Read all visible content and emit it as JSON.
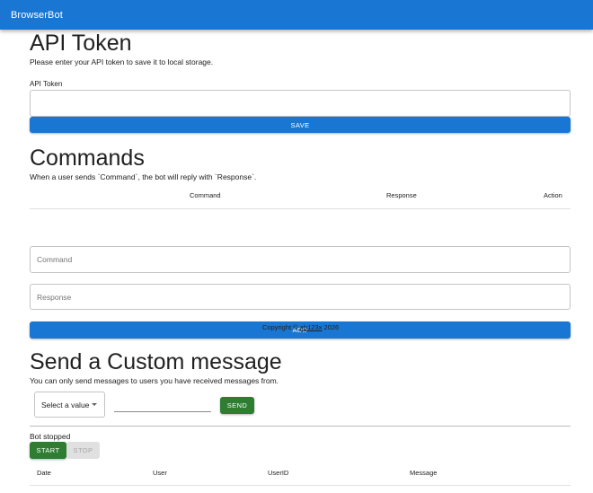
{
  "app": {
    "title": "BrowserBot"
  },
  "api_token": {
    "title": "API Token",
    "description": "Please enter your API token to save it to local storage.",
    "field_label": "API Token",
    "field_value": "",
    "save_label": "SAVE"
  },
  "commands": {
    "title": "Commands",
    "description": "When a user sends `Command`, the bot will reply with `Response`.",
    "columns": [
      "Command",
      "Response",
      "Action"
    ],
    "command_placeholder": "Command",
    "response_placeholder": "Response",
    "add_label": "ADD"
  },
  "footer": {
    "prefix": "Copyright © ",
    "link": "ab123x",
    "year": " 2026"
  },
  "custom_message": {
    "title": "Send a Custom message",
    "description": "You can only send messages to users you have received messages from.",
    "select_value": "Select a value",
    "message_value": "",
    "send_label": "SEND"
  },
  "bot": {
    "status": "Bot stopped",
    "start_label": "START",
    "stop_label": "STOP",
    "columns": [
      "Date",
      "User",
      "UserID",
      "Message"
    ]
  },
  "colors": {
    "primary": "#1976d2",
    "success": "#2e7d32",
    "disabled": "#e0e0e0"
  }
}
